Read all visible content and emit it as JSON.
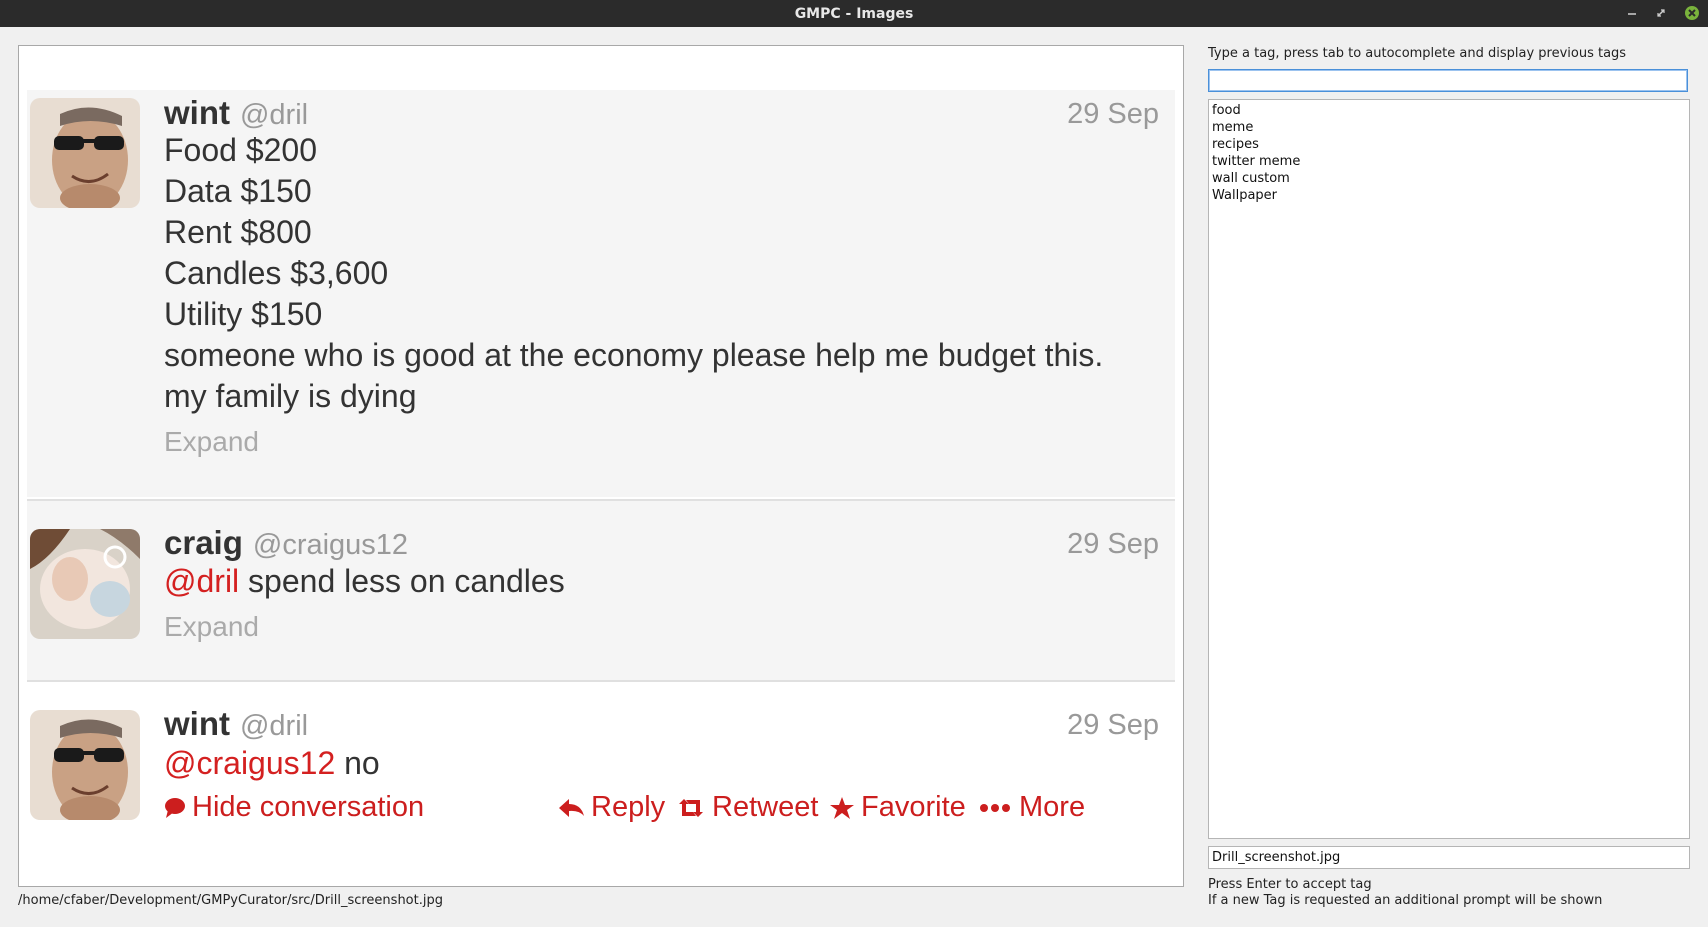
{
  "window": {
    "title": "GMPC - Images"
  },
  "tweets": [
    {
      "name": "wint",
      "handle": "@dril",
      "date": "29 Sep",
      "lines": [
        "Food $200",
        "Data $150",
        "Rent $800",
        "Candles $3,600",
        "Utility $150",
        "someone who is good at the economy please help me budget this.",
        "my family is dying"
      ],
      "expand": "Expand"
    },
    {
      "name": "craig",
      "handle": "@craigus12",
      "date": "29 Sep",
      "mention": "@dril",
      "text": " spend less on candles",
      "expand": "Expand"
    },
    {
      "name": "wint",
      "handle": "@dril",
      "date": "29 Sep",
      "mention": "@craigus12",
      "text": " no",
      "actions": {
        "hide": "Hide conversation",
        "reply": "Reply",
        "retweet": "Retweet",
        "favorite": "Favorite",
        "more": "More"
      }
    }
  ],
  "status_path": "/home/cfaber/Development/GMPyCurator/src/Drill_screenshot.jpg",
  "sidebar": {
    "instruction": "Type a tag, press tab to autocomplete and display previous tags",
    "tag_input_value": "",
    "tags": [
      "food",
      "meme",
      "recipes",
      "twitter meme",
      "wall custom",
      "Wallpaper"
    ],
    "filename": "Drill_screenshot.jpg",
    "help_line1": "Press Enter to accept tag",
    "help_line2": "If a new Tag is requested an additional prompt will be shown"
  },
  "colors": {
    "mention": "#d42020",
    "titlebar": "#2b2b2b",
    "close": "#7ab33c"
  }
}
